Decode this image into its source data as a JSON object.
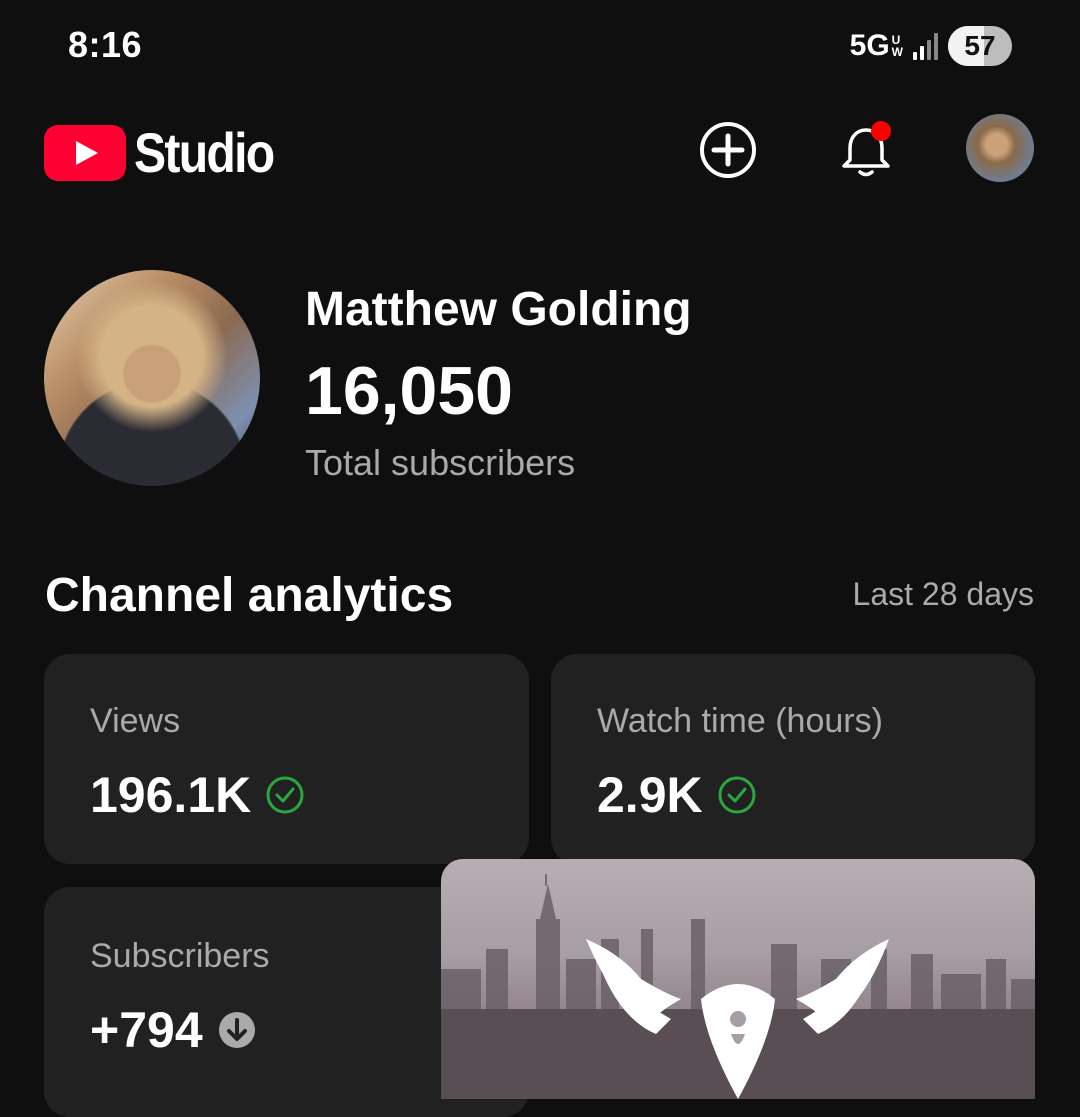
{
  "status_bar": {
    "time": "8:16",
    "network": "5G",
    "network_sub_top": "U",
    "network_sub_bottom": "W",
    "battery": "57",
    "battery_level": 0.57
  },
  "app_bar": {
    "app_name": "Studio",
    "icons": [
      "youtube-logo-icon",
      "create-plus-icon",
      "notifications-bell-icon",
      "account-avatar"
    ],
    "notification_dot_color": "#ff0000"
  },
  "channel": {
    "name": "Matthew Golding",
    "subscriber_count": "16,050",
    "subscriber_label": "Total subscribers"
  },
  "analytics": {
    "title": "Channel analytics",
    "period": "Last 28 days",
    "cards": [
      {
        "label": "Views",
        "value": "196.1K",
        "status_icon": "check-circle-icon",
        "status_color": "#2ba640"
      },
      {
        "label": "Watch time (hours)",
        "value": "2.9K",
        "status_icon": "check-circle-icon",
        "status_color": "#2ba640"
      },
      {
        "label": "Subscribers",
        "value": "+794",
        "status_icon": "arrow-down-circle-icon",
        "status_color": "#aaaaaa"
      }
    ]
  },
  "colors": {
    "background": "#0f0f0f",
    "card": "#212121",
    "brand_red": "#ff0033",
    "secondary_text": "#aaaaaa"
  }
}
